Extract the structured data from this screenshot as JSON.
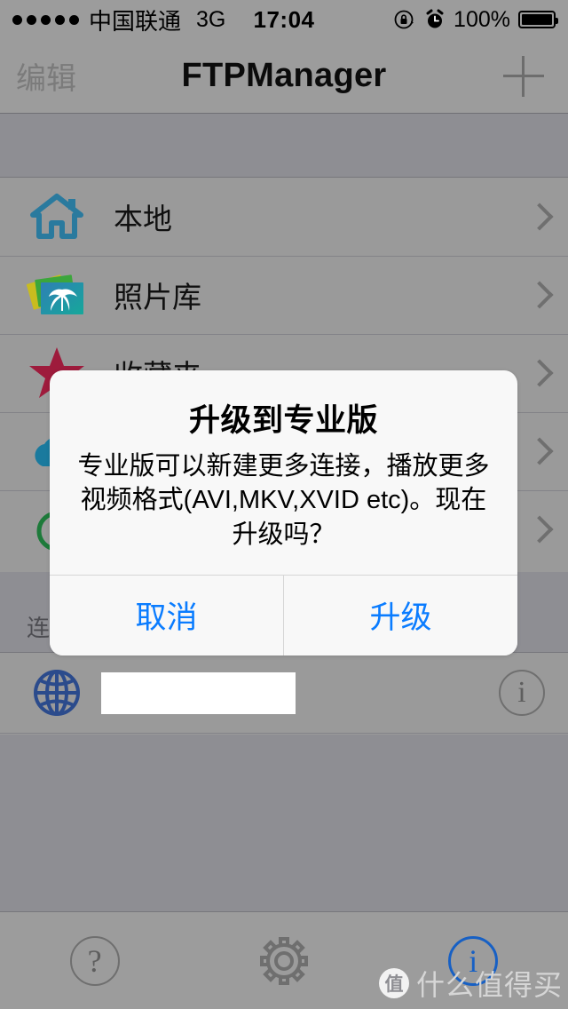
{
  "status_bar": {
    "signal_dots": 5,
    "carrier": "中国联通",
    "network": "3G",
    "time": "17:04",
    "rotation_lock_icon": "rotation-lock-icon",
    "alarm_icon": "alarm-clock-icon",
    "battery_percent": "100%",
    "battery_icon": "battery-full-icon"
  },
  "nav_bar": {
    "edit_label": "编辑",
    "title": "FTPManager",
    "add_icon": "plus-icon"
  },
  "sections": [
    {
      "header": "",
      "rows": [
        {
          "icon": "home-icon",
          "label": "本地",
          "chevron": "chevron-right-icon"
        },
        {
          "icon": "photos-icon",
          "label": "照片库",
          "chevron": "chevron-right-icon"
        },
        {
          "icon": "star-icon",
          "label": "收藏夹",
          "chevron": "chevron-right-icon"
        },
        {
          "icon": "cloud-icon",
          "label": "",
          "chevron": "chevron-right-icon"
        },
        {
          "icon": "green-icon",
          "label": "",
          "chevron": "chevron-right-icon"
        }
      ]
    },
    {
      "header": "连接",
      "rows": [
        {
          "icon": "globe-icon",
          "label": "",
          "redacted": true,
          "info_icon": "info-circle-icon"
        }
      ]
    }
  ],
  "toolbar": {
    "help_label": "?",
    "help_icon": "question-circle-icon",
    "settings_icon": "gear-icon",
    "info_label": "i",
    "info_icon": "info-circle-icon"
  },
  "watermark": {
    "logo_char": "值",
    "text": "什么值得买"
  },
  "alert": {
    "title": "升级到专业版",
    "message": "专业版可以新建更多连接，播放更多视频格式(AVI,MKV,XVID etc)。现在升级吗？",
    "cancel_label": "取消",
    "confirm_label": "升级"
  },
  "colors": {
    "accent_blue": "#0a7cff",
    "home_icon": "#2a7a9e",
    "star_icon": "#9e1b3c",
    "globe_icon": "#2b4b8c",
    "toolbar_active": "#1760c4",
    "chrome_gray": "#9c9c9c",
    "section_gray": "#8e8e93",
    "list_gray": "#9a9a9a"
  }
}
